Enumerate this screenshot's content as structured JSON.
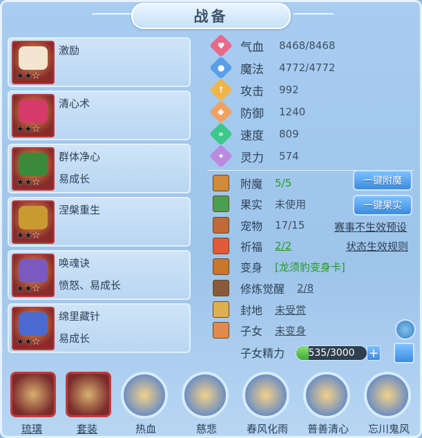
{
  "title": "战备",
  "skills": [
    {
      "name": "激励",
      "sub": "",
      "stars_filled": 2,
      "stars_total": 3
    },
    {
      "name": "清心术",
      "sub": "",
      "stars_filled": 2,
      "stars_total": 3
    },
    {
      "name": "群体净心",
      "sub": "易成长",
      "stars_filled": 2,
      "stars_total": 3
    },
    {
      "name": "涅槃重生",
      "sub": "",
      "stars_filled": 2,
      "stars_total": 3
    },
    {
      "name": "唤魂诀",
      "sub": "愤怒、易成长",
      "stars_filled": 2,
      "stars_total": 3
    },
    {
      "name": "绵里藏针",
      "sub": "易成长",
      "stars_filled": 2,
      "stars_total": 3
    }
  ],
  "stats": [
    {
      "label": "气血",
      "value": "8468/8468",
      "icon": "heart-icon",
      "color": "#e86a8a"
    },
    {
      "label": "魔法",
      "value": "4772/4772",
      "icon": "magic-icon",
      "color": "#5a9ee8"
    },
    {
      "label": "攻击",
      "value": "992",
      "icon": "sword-icon",
      "color": "#f0b54a"
    },
    {
      "label": "防御",
      "value": "1240",
      "icon": "shield-icon",
      "color": "#f0a060"
    },
    {
      "label": "速度",
      "value": "809",
      "icon": "speed-icon",
      "color": "#3cc88a"
    },
    {
      "label": "灵力",
      "value": "574",
      "icon": "spirit-icon",
      "color": "#b98ae0"
    }
  ],
  "rows": [
    {
      "label": "附魔",
      "value": "5/5",
      "green": true,
      "icon": "enchant-icon"
    },
    {
      "label": "果实",
      "value": "未使用",
      "green": false,
      "icon": "fruit-icon"
    },
    {
      "label": "宠物",
      "value": "17/15",
      "green": false,
      "icon": "pet-icon"
    },
    {
      "label": "祈福",
      "value": "2/2",
      "green": true,
      "icon": "bless-icon"
    },
    {
      "label": "变身",
      "value": "[龙须豹变身卡]",
      "green": true,
      "icon": "transform-icon"
    },
    {
      "label": "修炼觉醒",
      "value": "2/8",
      "green": false,
      "icon": "cultivate-icon"
    },
    {
      "label": "封地",
      "value": "未受赏",
      "green": false,
      "icon": "fief-icon"
    },
    {
      "label": "子女",
      "value": "未变身",
      "green": false,
      "icon": "child-icon"
    }
  ],
  "buttons": {
    "enchant": "一键附魔",
    "fruit": "一键果实"
  },
  "links": {
    "pet": "赛事不生效预设",
    "bless": "状态生效规则"
  },
  "child_energy": {
    "label": "子女精力",
    "value": "535/3000",
    "current": 535,
    "max": 3000
  },
  "bottom": [
    {
      "label": "琉璃",
      "shape": "square",
      "underline": true
    },
    {
      "label": "套装",
      "shape": "square",
      "underline": true
    },
    {
      "label": "热血",
      "shape": "round",
      "underline": false
    },
    {
      "label": "慈悲",
      "shape": "round",
      "underline": false
    },
    {
      "label": "春风化雨",
      "shape": "round",
      "underline": false
    },
    {
      "label": "普善清心",
      "shape": "round",
      "underline": false
    },
    {
      "label": "忘川鬼风",
      "shape": "round",
      "underline": false
    }
  ]
}
